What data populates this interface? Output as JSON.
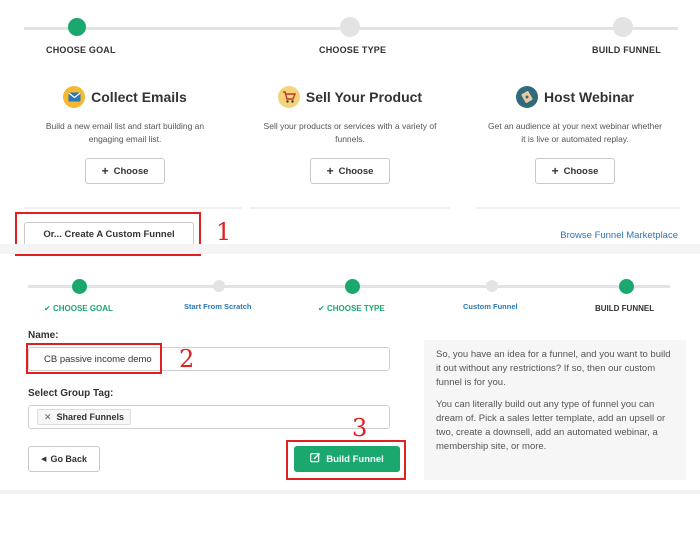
{
  "top_steps": [
    {
      "label": "CHOOSE GOAL",
      "state": "active"
    },
    {
      "label": "CHOOSE TYPE",
      "state": "pending"
    },
    {
      "label": "BUILD FUNNEL",
      "state": "pending"
    }
  ],
  "goals": [
    {
      "title": "Collect Emails",
      "description": "Build a new email list and start building an engaging email list.",
      "button": "Choose",
      "icon": "envelope-icon",
      "icon_color": "#f5b82e"
    },
    {
      "title": "Sell Your Product",
      "description": "Sell your products or services with a variety of funnels.",
      "button": "Choose",
      "icon": "shopping-cart-icon",
      "icon_color": "#f5b82e"
    },
    {
      "title": "Host Webinar",
      "description": "Get an audience at your next webinar whether it is live or automated replay.",
      "button": "Choose",
      "icon": "film-reel-icon",
      "icon_color": "#2f6b7a"
    }
  ],
  "custom_funnel_button": "Or... Create A Custom Funnel",
  "browse_link": "Browse Funnel Marketplace",
  "bottom_steps": [
    {
      "label": "CHOOSE GOAL",
      "state": "done"
    },
    {
      "label": "Start From Scratch",
      "state": "substep"
    },
    {
      "label": "CHOOSE TYPE",
      "state": "done"
    },
    {
      "label": "Custom Funnel",
      "state": "substep"
    },
    {
      "label": "BUILD FUNNEL",
      "state": "active"
    }
  ],
  "form": {
    "name_label": "Name:",
    "name_value": "CB passive income demo",
    "group_label": "Select Group Tag:",
    "tag": "Shared Funnels",
    "back_button": "Go Back",
    "build_button": "Build Funnel"
  },
  "help": {
    "p1": "So, you have an idea for a funnel, and you want to build it out without any restrictions? If so, then our custom funnel is for you.",
    "p2": "You can literally build out any type of funnel you can dream of. Pick a sales letter template, add an upsell or two, create a downsell, add an automated webinar, a membership site, or more."
  },
  "annotations": [
    "1",
    "2",
    "3"
  ],
  "colors": {
    "accent": "#1aa86f",
    "link": "#2a77b8",
    "annotation": "#e02020"
  }
}
